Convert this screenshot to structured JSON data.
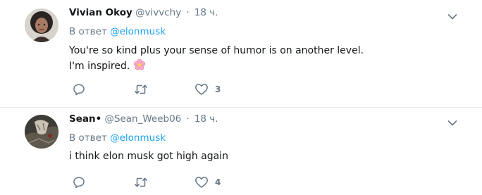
{
  "tweets": [
    {
      "fullname": "Vivian Okoy",
      "handle": "@vivvchy",
      "separator": "·",
      "time": "18 ч.",
      "reply_prefix": "В ответ",
      "reply_mention": "@elonmusk",
      "text_line1": "You're so kind plus your sense of humor is on another level.",
      "text_line2": "I'm inspired.",
      "like_count": "3",
      "emoji": "cherry-blossom-icon"
    },
    {
      "fullname": "Sean•",
      "handle": "@Sean_Weeb06",
      "separator": "·",
      "time": "18 ч.",
      "reply_prefix": "В ответ",
      "reply_mention": "@elonmusk",
      "text_line1": "i think elon musk got high again",
      "like_count": "4"
    }
  ],
  "colors": {
    "accent": "#1da1f2",
    "secondary_text": "#657786",
    "primary_text": "#14171a",
    "divider": "#e6ecf0"
  },
  "icons": {
    "reply": "reply-icon",
    "retweet": "retweet-icon",
    "like": "heart-icon",
    "more": "chevron-down-icon"
  }
}
